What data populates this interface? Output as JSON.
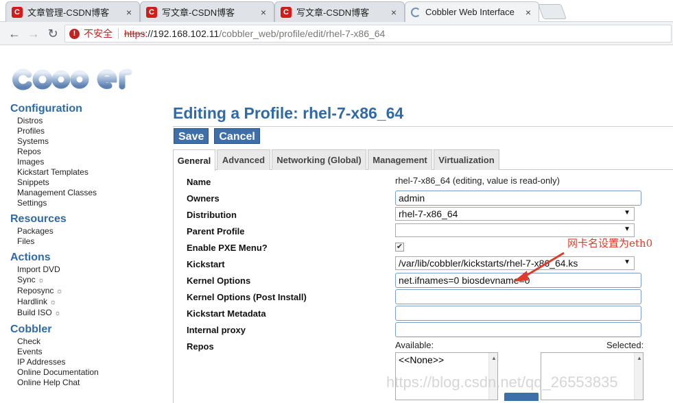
{
  "browser": {
    "tabs": [
      {
        "title": "文章管理-CSDN博客",
        "favicon": "C"
      },
      {
        "title": "写文章-CSDN博客",
        "favicon": "C"
      },
      {
        "title": "写文章-CSDN博客",
        "favicon": "C"
      },
      {
        "title": "Cobbler Web Interface",
        "favicon": "loading"
      }
    ],
    "close_glyph": "×",
    "url": {
      "security_label": "不安全",
      "scheme": "https",
      "host": "://192.168.102.11",
      "path": "/cobbler_web/profile/edit/rhel-7-x86_64"
    }
  },
  "sidebar": {
    "sections": [
      {
        "title": "Configuration",
        "items": [
          "Distros",
          "Profiles",
          "Systems",
          "Repos",
          "Images",
          "Kickstart Templates",
          "Snippets",
          "Management Classes",
          "Settings"
        ]
      },
      {
        "title": "Resources",
        "items": [
          "Packages",
          "Files"
        ]
      },
      {
        "title": "Actions",
        "items": [
          "Import DVD",
          "Sync",
          "Reposync",
          "Hardlink",
          "Build ISO"
        ]
      },
      {
        "title": "Cobbler",
        "items": [
          "Check",
          "Events",
          "IP Addresses",
          "Online Documentation",
          "Online Help Chat"
        ]
      }
    ],
    "gear_glyph": "☼"
  },
  "main": {
    "title": "Editing a Profile: rhel-7-x86_64",
    "save_label": "Save",
    "cancel_label": "Cancel",
    "tabs": [
      "General",
      "Advanced",
      "Networking (Global)",
      "Management",
      "Virtualization"
    ],
    "fields": {
      "name": {
        "label": "Name",
        "value": "rhel-7-x86_64 (editing, value is read-only)"
      },
      "owners": {
        "label": "Owners",
        "value": "admin"
      },
      "distribution": {
        "label": "Distribution",
        "value": "rhel-7-x86_64"
      },
      "parent_profile": {
        "label": "Parent Profile",
        "value": ""
      },
      "enable_pxe": {
        "label": "Enable PXE Menu?",
        "checked": true
      },
      "kickstart": {
        "label": "Kickstart",
        "value": "/var/lib/cobbler/kickstarts/rhel-7-x86_64.ks"
      },
      "kernel_options": {
        "label": "Kernel Options",
        "value": "net.ifnames=0 biosdevname=0"
      },
      "kernel_options_post": {
        "label": "Kernel Options (Post Install)",
        "value": ""
      },
      "kickstart_metadata": {
        "label": "Kickstart Metadata",
        "value": ""
      },
      "internal_proxy": {
        "label": "Internal proxy",
        "value": ""
      },
      "repos": {
        "label": "Repos",
        "available_label": "Available:",
        "selected_label": "Selected:",
        "available_items": [
          "<<None>>"
        ]
      }
    }
  },
  "annotation": {
    "text": "网卡名设置为eth0",
    "color": "#e03b2a"
  },
  "watermark": "https://blog.csdn.net/qq_26553835"
}
